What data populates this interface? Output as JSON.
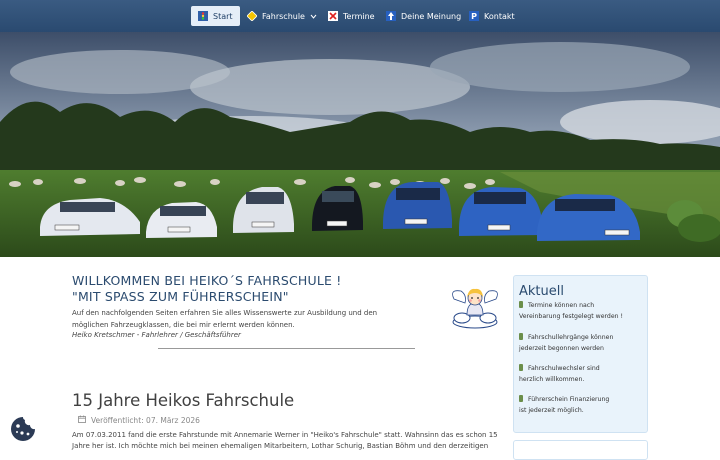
{
  "nav": {
    "items": [
      {
        "label": "Start",
        "icon": "traffic-light-icon"
      },
      {
        "label": "Fahrschule",
        "icon": "warning-sign-icon"
      },
      {
        "label": "Termine",
        "icon": "no-stopping-icon"
      },
      {
        "label": "Deine Meinung",
        "icon": "one-way-icon"
      },
      {
        "label": "Kontakt",
        "icon": "parking-icon"
      }
    ]
  },
  "welcome": {
    "title_line1": "WILLKOMMEN BEI HEIKO´S FAHRSCHULE !",
    "title_line2": "\"MIT SPASS ZUM FÜHRERSCHEIN\"",
    "text": "Auf den nachfolgenden Seiten erfahren Sie alles Wissenswerte zur Ausbildung und den möglichen Fahrzeugklassen, die bei mir erlernt werden können.",
    "author": "Heiko Kretschmer - Fahrlehrer / Geschäftsführer"
  },
  "post": {
    "title": "15 Jahre Heikos Fahrschule",
    "meta": "Veröffentlicht: 07. März 2026",
    "text": "Am 07.03.2011 fand die erste Fahrstunde mit Annemarie Werner in \"Heiko's Fahrschule\" statt. Wahnsinn das es schon 15 Jahre her ist. Ich möchte mich bei meinen ehemaligen Mitarbeitern, Lothar Schurig, Bastian Böhm und den derzeitigen"
  },
  "sidebar": {
    "title": "Aktuell",
    "items": [
      {
        "line1": "Termine können nach",
        "line2": "Vereinbarung festgelegt werden !"
      },
      {
        "line1": "Fahrschullehrgänge können",
        "line2": "jederzeit begonnen werden"
      },
      {
        "line1": "Fahrschulwechsler sind",
        "line2": "herzlich willkommen."
      },
      {
        "line1": "Führerschein Finanzierung",
        "line2": "ist jederzeit möglich."
      }
    ]
  },
  "colors": {
    "nav_bg": "#2f507a",
    "accent": "#2b4b6f",
    "sidebar_bg": "#e9f3fb"
  }
}
